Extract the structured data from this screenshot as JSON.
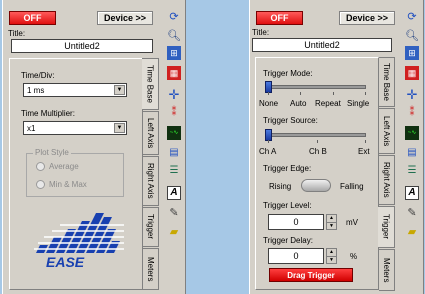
{
  "colors": {
    "background": "#a6c8e6",
    "panel": "#d4d0c8",
    "off_button": "#e01010",
    "drag_trigger": "#d00000",
    "slider_thumb": "#1a3aa0",
    "logo_blue": "#1840b0"
  },
  "left_panel": {
    "off_label": "OFF",
    "device_label": "Device >>",
    "title_label": "Title:",
    "title_value": "Untitled2",
    "timediv_label": "Time/Div:",
    "timediv_value": "1 ms",
    "multiplier_label": "Time Multiplier:",
    "multiplier_value": "x1",
    "plot_style_label": "Plot Style",
    "plot_style_options": [
      "Average",
      "Min & Max"
    ],
    "logo_text": "EASE",
    "tabs": [
      "Time Base",
      "Left Axis",
      "Right Axis",
      "Trigger",
      "Meters"
    ],
    "active_tab": "Time Base"
  },
  "right_panel": {
    "off_label": "OFF",
    "device_label": "Device >>",
    "title_label": "Title:",
    "title_value": "Untitled2",
    "trigger_mode_label": "Trigger Mode:",
    "trigger_mode_options": [
      "None",
      "Auto",
      "Repeat",
      "Single"
    ],
    "trigger_mode_selected": "None",
    "trigger_source_label": "Trigger Source:",
    "trigger_source_options": [
      "Ch A",
      "Ch B",
      "Ext"
    ],
    "trigger_source_selected": "Ch A",
    "trigger_edge_label": "Trigger Edge:",
    "edge_rising": "Rising",
    "edge_falling": "Falling",
    "trigger_level_label": "Trigger Level:",
    "trigger_level_value": "0",
    "trigger_level_unit": "mV",
    "trigger_delay_label": "Trigger Delay:",
    "trigger_delay_value": "0",
    "trigger_delay_unit": "%",
    "drag_trigger_label": "Drag Trigger",
    "tabs": [
      "Time Base",
      "Left Axis",
      "Right Axis",
      "Trigger",
      "Meters"
    ],
    "active_tab": "Trigger"
  },
  "toolbar_icons": [
    "graph-refresh-icon",
    "zoom-icon",
    "zoom-fit-icon",
    "grid-icon",
    "crosshair-icon",
    "marker-icon",
    "scope-display-icon",
    "channel-icon",
    "list-icon",
    "text-icon",
    "note-icon",
    "eraser-icon"
  ]
}
